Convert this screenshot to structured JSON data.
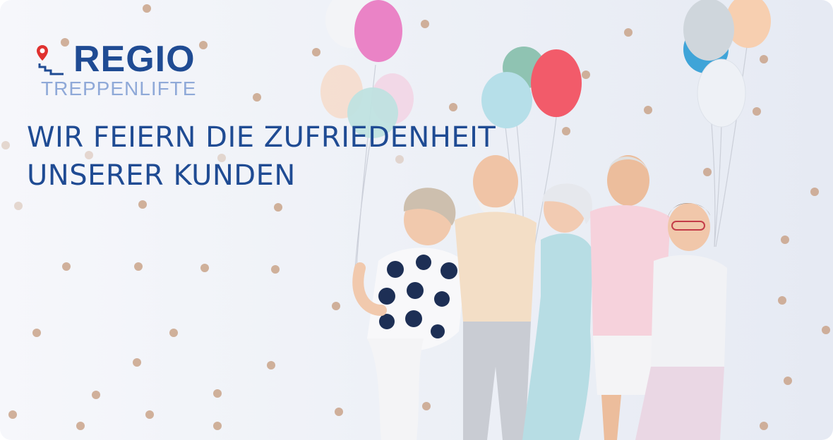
{
  "logo": {
    "brand": "REGIO",
    "subtitle": "TREPPENLIFTE",
    "icon": "stair-lift-pin-icon",
    "brand_color": "#1f4b93",
    "subtitle_color": "#8fa9d8",
    "pin_color": "#e0312f"
  },
  "headline": {
    "line1": "WIR FEIERN DIE ZUFRIEDENHEIT",
    "line2": "UNSERER KUNDEN"
  },
  "image": {
    "subject": "group-of-five-seniors-with-balloons"
  }
}
